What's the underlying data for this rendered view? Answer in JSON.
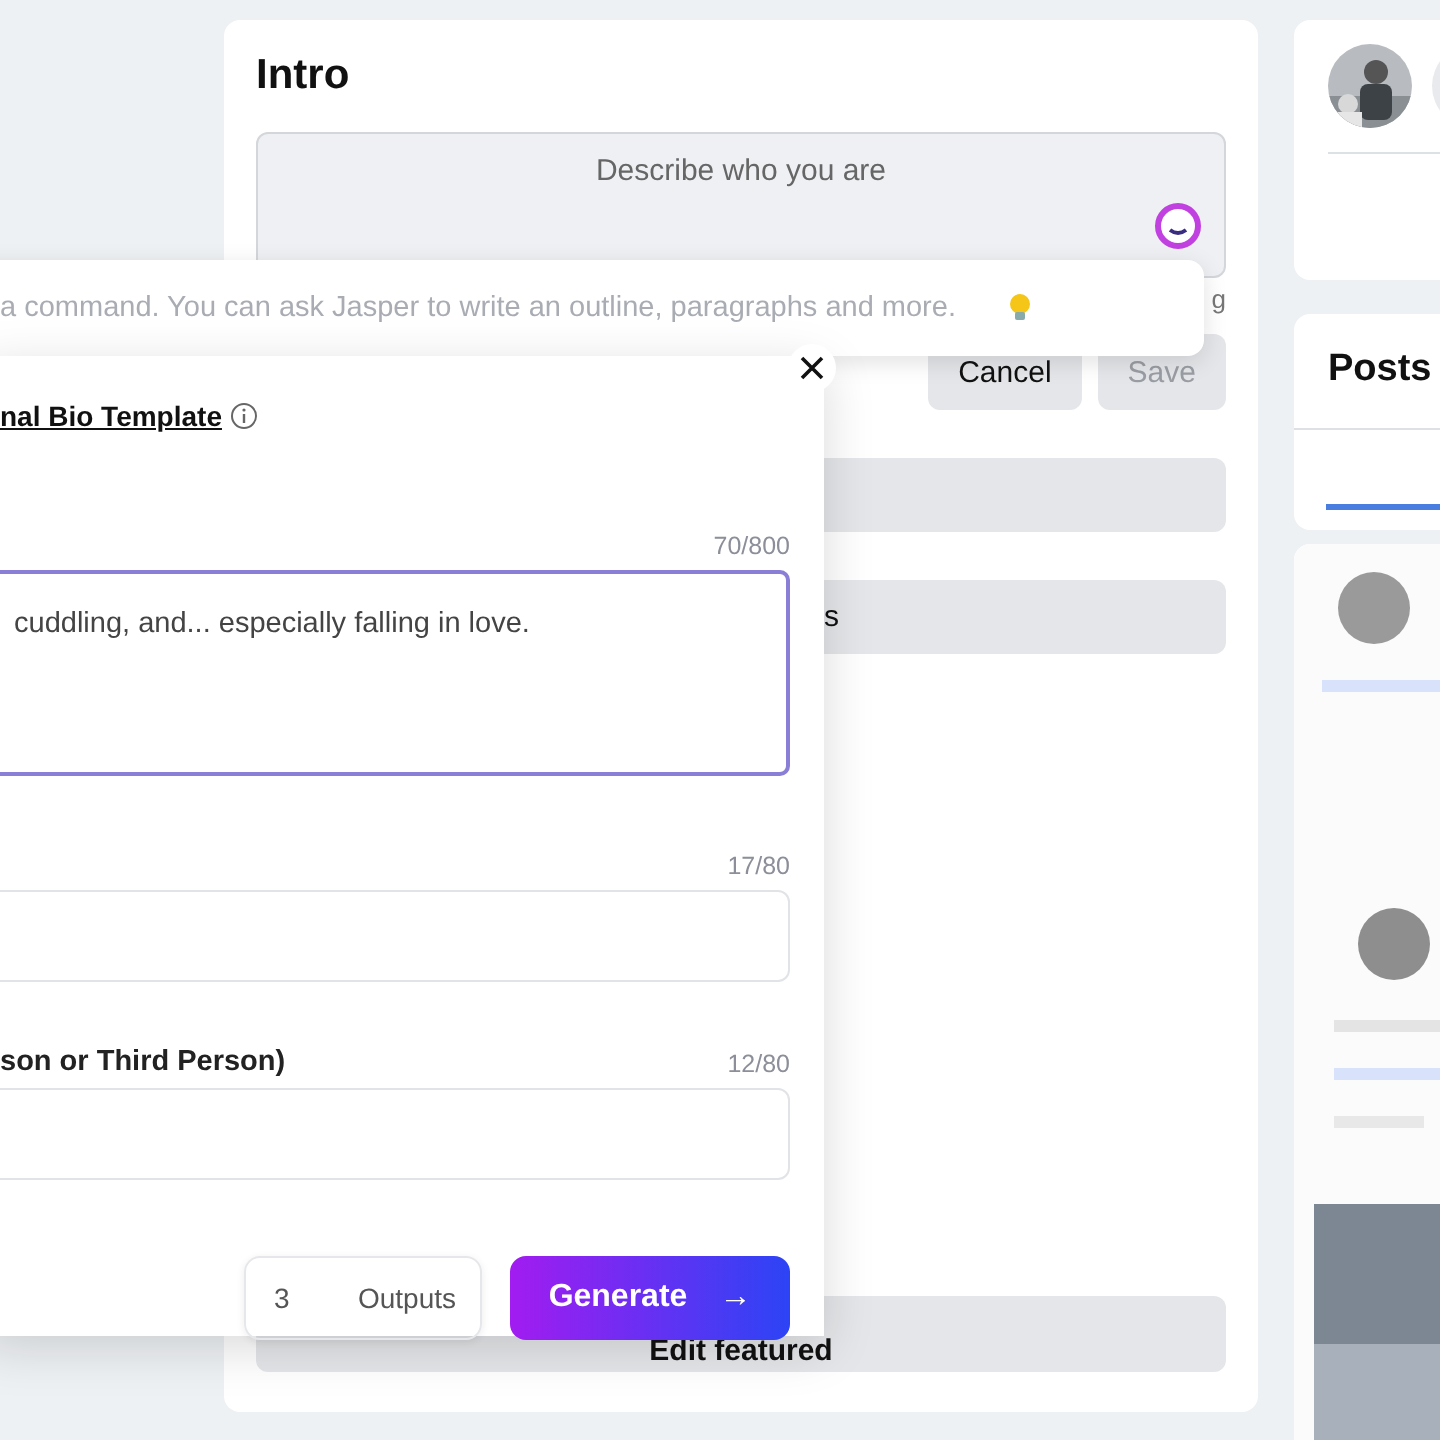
{
  "intro_card": {
    "title": "Intro",
    "bio_field": {
      "placeholder": "Describe who you are"
    },
    "hint_fragment": "g",
    "buttons": [
      {
        "label": "Cancel",
        "disabled": false
      },
      {
        "label": "Save",
        "disabled": true
      }
    ],
    "row_fragment": "s",
    "edit_featured": "Edit featured"
  },
  "posts_card": {
    "title": "Posts"
  },
  "command_bar": {
    "placeholder": "a command. You can ask Jasper to write an outline, paragraphs and more."
  },
  "template_panel": {
    "title": "nal Bio Template",
    "fields": [
      {
        "kind": "textarea",
        "counter": "70/800",
        "value": "cuddling, and... especially falling in love.",
        "focused": true
      },
      {
        "kind": "input",
        "counter": "17/80",
        "focused": false
      },
      {
        "kind": "input",
        "label": "son or Third Person)",
        "counter": "12/80",
        "focused": false
      }
    ],
    "outputs": {
      "count": "3",
      "label": "Outputs"
    },
    "generate": "Generate",
    "generate_arrow": "→"
  }
}
